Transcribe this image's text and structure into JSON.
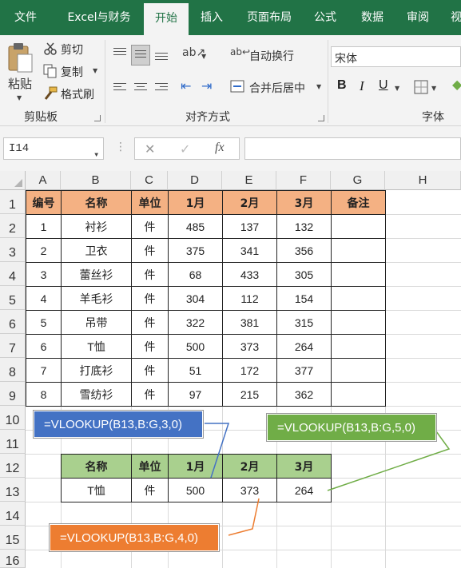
{
  "ribbon_tabs": [
    "文件",
    "Excel与财务",
    "开始",
    "插入",
    "页面布局",
    "公式",
    "数据",
    "审阅",
    "视"
  ],
  "active_tab": "开始",
  "clipboard": {
    "paste": "粘贴",
    "cut": "剪切",
    "copy": "复制",
    "format_painter": "格式刷",
    "group_label": "剪贴板"
  },
  "alignment": {
    "wrap_text": "自动换行",
    "merge_center": "合并后居中",
    "group_label": "对齐方式"
  },
  "font": {
    "font_name": "宋体",
    "bold": "B",
    "italic": "I",
    "underline": "U",
    "group_label": "字体"
  },
  "formula_bar": {
    "name_box": "I14",
    "cancel": "✕",
    "enter": "✓",
    "fx": "fx",
    "formula": ""
  },
  "columns": [
    "A",
    "B",
    "C",
    "D",
    "E",
    "F",
    "G",
    "H"
  ],
  "rows": [
    "1",
    "2",
    "3",
    "4",
    "5",
    "6",
    "7",
    "8",
    "9",
    "10",
    "11",
    "12",
    "13",
    "14",
    "15",
    "16"
  ],
  "main_table": {
    "headers": [
      "编号",
      "名称",
      "单位",
      "1月",
      "2月",
      "3月",
      "备注"
    ],
    "rows": [
      [
        "1",
        "衬衫",
        "件",
        "485",
        "137",
        "132",
        ""
      ],
      [
        "2",
        "卫衣",
        "件",
        "375",
        "341",
        "356",
        ""
      ],
      [
        "3",
        "蕾丝衫",
        "件",
        "68",
        "433",
        "305",
        ""
      ],
      [
        "4",
        "羊毛衫",
        "件",
        "304",
        "112",
        "154",
        ""
      ],
      [
        "5",
        "吊带",
        "件",
        "322",
        "381",
        "315",
        ""
      ],
      [
        "6",
        "T恤",
        "件",
        "500",
        "373",
        "264",
        ""
      ],
      [
        "7",
        "打底衫",
        "件",
        "51",
        "172",
        "377",
        ""
      ],
      [
        "8",
        "雪纺衫",
        "件",
        "97",
        "215",
        "362",
        ""
      ]
    ]
  },
  "lookup_table": {
    "headers": [
      "名称",
      "单位",
      "1月",
      "2月",
      "3月"
    ],
    "row": [
      "T恤",
      "件",
      "500",
      "373",
      "264"
    ]
  },
  "callouts": {
    "blue": "=VLOOKUP(B13,B:G,3,0)",
    "green": "=VLOOKUP(B13,B:G,5,0)",
    "orange": "=VLOOKUP(B13,B:G,4,0)"
  },
  "colors": {
    "ribbon_green": "#217346",
    "header_orange": "#f4b183",
    "header_green": "#a9d08e",
    "callout_blue": "#4472c4",
    "callout_green": "#70ad47",
    "callout_orange": "#ed7d31"
  }
}
